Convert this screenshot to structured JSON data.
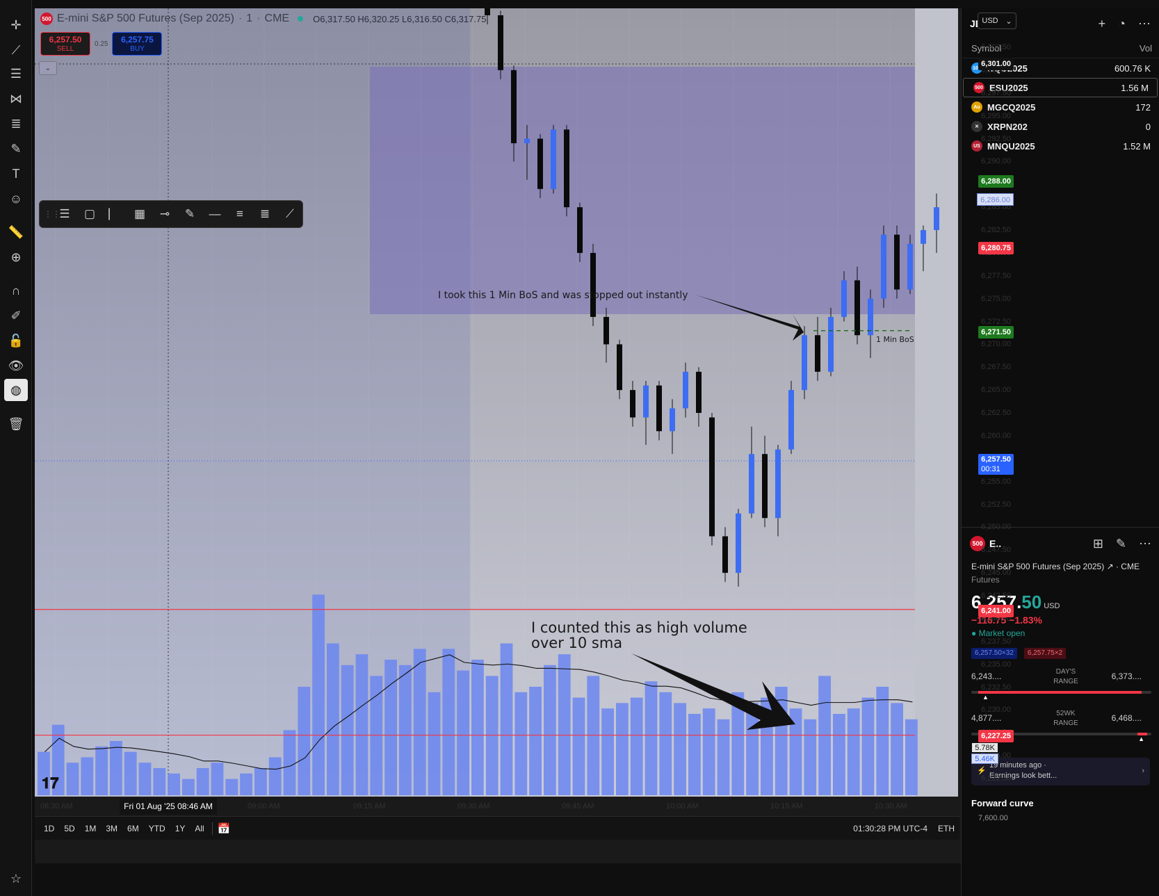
{
  "header": {
    "symbol_badge": "500",
    "title": "E-mini S&P 500 Futures (Sep 2025)",
    "interval": "1",
    "exchange": "CME",
    "ohlc": "O6,317.50  H6,320.25  L6,316.50  C6,317.75",
    "sell_price": "6,257.50",
    "sell_label": "SELL",
    "spread": "0.25",
    "buy_price": "6,257.75",
    "buy_label": "BUY",
    "currency": "USD"
  },
  "price_axis": {
    "ticks": [
      "6,302.50",
      "6,300.00",
      "6,297.50",
      "6,295.00",
      "6,292.50",
      "6,290.00",
      "6,287.50",
      "6,285.00",
      "6,282.50",
      "6,280.00",
      "6,277.50",
      "6,275.00",
      "6,272.50",
      "6,270.00",
      "6,267.50",
      "6,265.00",
      "6,262.50",
      "6,260.00",
      "6,257.50",
      "6,255.00",
      "6,252.50",
      "6,250.00",
      "6,247.50",
      "6,245.00",
      "6,242.50",
      "6,240.00",
      "6,237.50",
      "6,235.00",
      "6,232.50",
      "6,230.00",
      "6,227.50",
      "6,225.00",
      "6,222.50"
    ],
    "tag_6301": "6,301.00",
    "tag_6288": "6,288.00",
    "tag_6286": "6,286.00",
    "tag_6280": "6,280.75",
    "tag_6271": "6,271.50",
    "tag_last": "6,257.50",
    "tag_timer": "00:31",
    "tag_6241": "6,241.00",
    "tag_6227": "6,227.25",
    "vol_1": "5.78K",
    "vol_2": "5.46K"
  },
  "time_axis": {
    "labels": [
      "08:30 AM",
      "09:00 AM",
      "09:15 AM",
      "09:30 AM",
      "09:45 AM",
      "10:00 AM",
      "10:15 AM",
      "10:30 AM"
    ],
    "crosshair": "Fri 01 Aug '25   08:46 AM"
  },
  "annotations": {
    "bos_note": "I took this 1 Min BoS and was stopped out instantly",
    "bos_label": "1 Min BoS",
    "volume_note_1": "I counted this as high volume",
    "volume_note_2": "over 10 sma"
  },
  "range_bar": {
    "ranges": [
      "1D",
      "5D",
      "1M",
      "3M",
      "6M",
      "YTD",
      "1Y",
      "All"
    ],
    "clock": "01:30:28 PM UTC-4",
    "session": "ETH"
  },
  "watchlist": {
    "name": "JDM",
    "col_symbol": "Symbol",
    "col_vol": "Vol",
    "rows": [
      {
        "icon": "100",
        "symbol": "NQU2025",
        "vol": "600.76 K",
        "color": "#2196f3"
      },
      {
        "icon": "500",
        "symbol": "ESU2025",
        "vol": "1.56 M",
        "color": "#d3172e"
      },
      {
        "icon": "Au",
        "symbol": "MGCQ2025",
        "vol": "172",
        "color": "#e0a100"
      },
      {
        "icon": "✕",
        "symbol": "XRPN202",
        "vol": "0",
        "color": "#333333"
      },
      {
        "icon": "US",
        "symbol": "MNQU2025",
        "vol": "1.52 M",
        "color": "#b22234"
      }
    ]
  },
  "details": {
    "short": "E..",
    "name": "E-mini S&P 500 Futures (Sep 2025)",
    "exchange": "CME",
    "type": "Futures",
    "price_main": "6,257.",
    "price_frac": "50",
    "currency": "USD",
    "change": "−116.75  −1.83%",
    "status": "Market open",
    "bid": "6,257.50×32",
    "ask": "6,257.75×2",
    "day_low": "6,243....",
    "day_high": "6,373....",
    "day_label": "DAY'S RANGE",
    "wk_low": "4,877....",
    "wk_high": "6,468....",
    "wk_label": "52WK RANGE",
    "news_time": "19 minutes ago ·",
    "news_text": "Earnings look bett...",
    "forward_curve": "Forward curve",
    "forward_val": "7,600.00"
  },
  "chart_data": {
    "type": "candlestick",
    "interval": "1",
    "ohlc": [
      [
        6317.5,
        6320.25,
        6316.5,
        6317.75
      ],
      [
        6317.75,
        6318.0,
        6305.0,
        6306.0
      ],
      [
        6306.0,
        6306.5,
        6299.0,
        6300.0
      ],
      [
        6300.0,
        6300.5,
        6290.0,
        6292.0
      ],
      [
        6292.0,
        6294.0,
        6288.0,
        6292.5
      ],
      [
        6292.5,
        6293.0,
        6286.0,
        6287.0
      ],
      [
        6287.0,
        6294.0,
        6286.5,
        6293.5
      ],
      [
        6293.5,
        6294.0,
        6284.0,
        6285.0
      ],
      [
        6285.0,
        6285.5,
        6279.0,
        6280.0
      ],
      [
        6280.0,
        6281.0,
        6272.0,
        6273.0
      ],
      [
        6273.0,
        6274.0,
        6268.0,
        6270.0
      ],
      [
        6270.0,
        6270.5,
        6264.0,
        6265.0
      ],
      [
        6265.0,
        6266.0,
        6261.0,
        6262.0
      ],
      [
        6262.0,
        6266.0,
        6259.0,
        6265.5
      ],
      [
        6265.5,
        6266.0,
        6259.5,
        6260.5
      ],
      [
        6260.5,
        6264.0,
        6258.0,
        6263.0
      ],
      [
        6263.0,
        6268.0,
        6262.0,
        6267.0
      ],
      [
        6267.0,
        6267.5,
        6261.0,
        6262.5
      ],
      [
        6262.0,
        6262.5,
        6248.0,
        6249.0
      ],
      [
        6249.0,
        6250.0,
        6244.0,
        6245.0
      ],
      [
        6245.0,
        6252.0,
        6243.5,
        6251.5
      ],
      [
        6251.5,
        6261.0,
        6251.0,
        6258.0
      ],
      [
        6258.0,
        6260.0,
        6250.0,
        6251.0
      ],
      [
        6251.0,
        6259.0,
        6249.0,
        6258.5
      ],
      [
        6258.5,
        6266.0,
        6258.0,
        6265.0
      ],
      [
        6265.0,
        6272.0,
        6264.0,
        6271.0
      ],
      [
        6271.0,
        6273.0,
        6266.0,
        6267.0
      ],
      [
        6267.0,
        6274.0,
        6266.5,
        6273.0
      ],
      [
        6273.0,
        6278.0,
        6272.5,
        6277.0
      ],
      [
        6277.0,
        6278.5,
        6270.0,
        6271.0
      ],
      [
        6271.0,
        6276.0,
        6268.5,
        6275.0
      ],
      [
        6275.0,
        6283.0,
        6274.0,
        6282.0
      ],
      [
        6282.0,
        6283.0,
        6275.0,
        6276.0
      ],
      [
        6276.0,
        6282.0,
        6275.5,
        6281.0
      ],
      [
        6281.0,
        6283.0,
        6278.0,
        6282.5
      ],
      [
        6282.5,
        6286.5,
        6280.0,
        6285.0
      ]
    ],
    "volume_values": [
      800,
      1300,
      600,
      700,
      900,
      1000,
      800,
      600,
      500,
      400,
      300,
      500,
      600,
      300,
      400,
      500,
      700,
      1200,
      2000,
      3700,
      2800,
      2400,
      2600,
      2200,
      2500,
      2400,
      2700,
      1900,
      2700,
      2300,
      2500,
      2200,
      2800,
      1900,
      2000,
      2400,
      2600,
      1800,
      2200,
      1600,
      1700,
      1800,
      2100,
      1900,
      1700,
      1500,
      1600,
      1400,
      1900,
      1700,
      1800,
      2000,
      1600,
      1400,
      2200,
      1500,
      1600,
      1800,
      2000,
      1700,
      1400
    ],
    "ylim": [
      6220,
      6304
    ],
    "lines": [
      {
        "label": "6,241.00",
        "value": 6241.0,
        "color": "#f23645"
      },
      {
        "label": "6,227.25",
        "value": 6227.25,
        "color": "#f23645"
      },
      {
        "label": "1 Min BoS",
        "value": 6271.5,
        "color": "#1f6b1f"
      }
    ]
  }
}
